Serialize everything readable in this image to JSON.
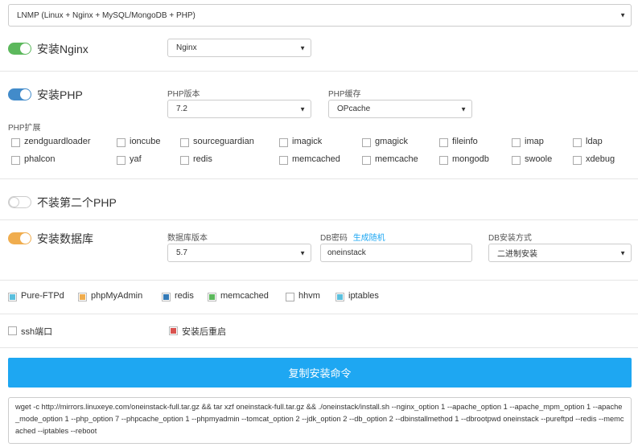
{
  "stack_select": {
    "value": "LNMP (Linux + Nginx + MySQL/MongoDB + PHP)"
  },
  "nginx": {
    "toggle_label": "安装Nginx",
    "select_value": "Nginx",
    "toggle_color": "#5cb85c"
  },
  "php": {
    "toggle_label": "安装PHP",
    "toggle_color": "#428bca",
    "version_label": "PHP版本",
    "version_value": "7.2",
    "cache_label": "PHP缓存",
    "cache_value": "OPcache",
    "ext_label": "PHP扩展",
    "extensions_row1": [
      "zendguardloader",
      "ioncube",
      "sourceguardian",
      "imagick",
      "gmagick",
      "fileinfo",
      "imap",
      "ldap"
    ],
    "extensions_row2": [
      "phalcon",
      "yaf",
      "redis",
      "memcached",
      "memcache",
      "mongodb",
      "swoole",
      "xdebug"
    ]
  },
  "second_php": {
    "toggle_label": "不装第二个PHP"
  },
  "database": {
    "toggle_label": "安装数据库",
    "toggle_color": "#f0ad4e",
    "version_label": "数据库版本",
    "version_value": "5.7",
    "pwd_label": "DB密码",
    "pwd_link": "生成随机",
    "pwd_value": "oneinstack",
    "method_label": "DB安装方式",
    "method_value": "二进制安装"
  },
  "extras": [
    {
      "label": "Pure-FTPd",
      "color": "#5bc0de"
    },
    {
      "label": "phpMyAdmin",
      "color": "#f0ad4e"
    },
    {
      "label": "redis",
      "color": "#337ab7"
    },
    {
      "label": "memcached",
      "color": "#5cb85c"
    },
    {
      "label": "hhvm",
      "color": ""
    },
    {
      "label": "iptables",
      "color": "#5bc0de"
    }
  ],
  "ssh_port_label": "ssh端口",
  "reboot_label": "安装后重启",
  "reboot_color": "#d9534f",
  "copy_button": "复制安装命令",
  "command": "wget -c http://mirrors.linuxeye.com/oneinstack-full.tar.gz && tar xzf oneinstack-full.tar.gz && ./oneinstack/install.sh --nginx_option 1 --apache_option 1 --apache_mpm_option 1 --apache_mode_option 1 --php_option 7 --phpcache_option 1 --phpmyadmin  --tomcat_option 2 --jdk_option 2 --db_option 2 --dbinstallmethod 1 --dbrootpwd oneinstack --pureftpd  --redis  --memcached  --iptables  --reboot"
}
